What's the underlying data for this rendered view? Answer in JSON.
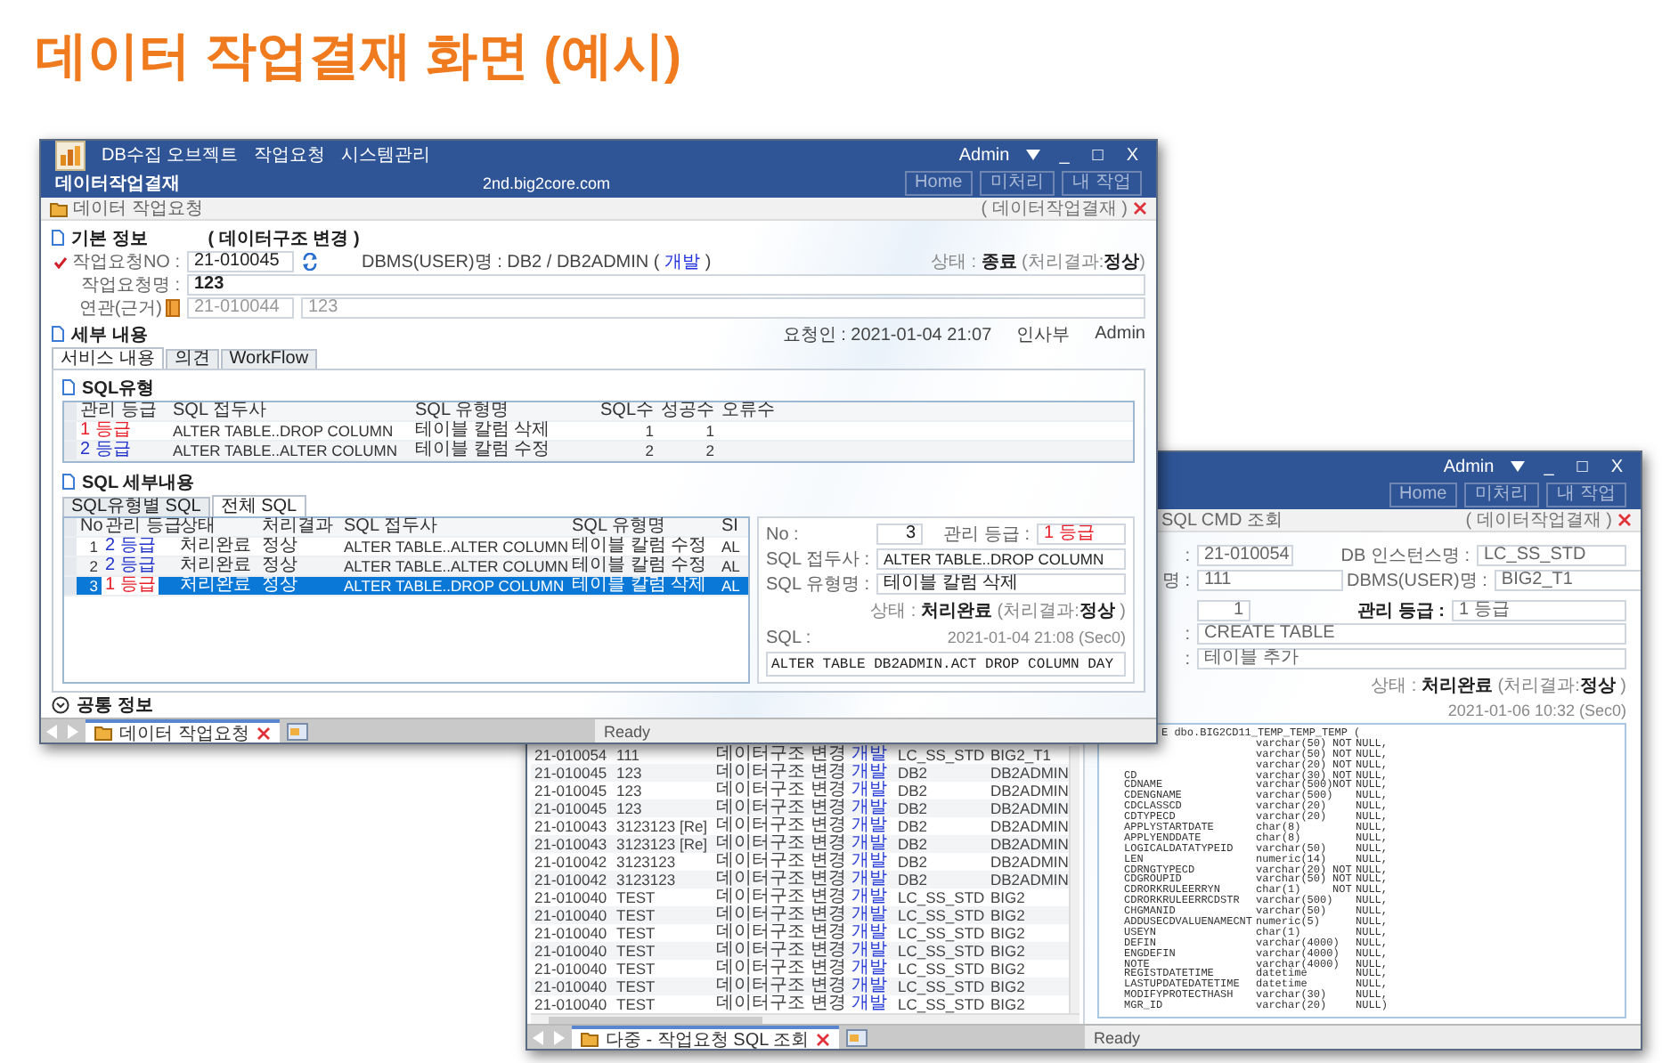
{
  "heading": "데이터 작업결재 화면 (예시)",
  "back_window": {
    "user": "Admin",
    "controls": [
      "_",
      "□",
      "X"
    ],
    "nav_buttons": [
      "Home",
      "미처리",
      "내 작업"
    ],
    "breadcrumb": "SQL CMD 조회",
    "breadcrumb_right": "( 데이터작업결재 )",
    "rows": [
      {
        "no": "21-010054",
        "name": "111",
        "type": "데이터구조 변경",
        "env": "개발",
        "instance": "LC_SS_STD",
        "user": "BIG2_T1"
      },
      {
        "no": "21-010045",
        "name": "123",
        "type": "데이터구조 변경",
        "env": "개발",
        "instance": "DB2",
        "user": "DB2ADMIN"
      },
      {
        "no": "21-010045",
        "name": "123",
        "type": "데이터구조 변경",
        "env": "개발",
        "instance": "DB2",
        "user": "DB2ADMIN"
      },
      {
        "no": "21-010045",
        "name": "123",
        "type": "데이터구조 변경",
        "env": "개발",
        "instance": "DB2",
        "user": "DB2ADMIN"
      },
      {
        "no": "21-010043",
        "name": "3123123 [Re]",
        "type": "데이터구조 변경",
        "env": "개발",
        "instance": "DB2",
        "user": "DB2ADMIN"
      },
      {
        "no": "21-010043",
        "name": "3123123 [Re]",
        "type": "데이터구조 변경",
        "env": "개발",
        "instance": "DB2",
        "user": "DB2ADMIN"
      },
      {
        "no": "21-010042",
        "name": "3123123",
        "type": "데이터구조 변경",
        "env": "개발",
        "instance": "DB2",
        "user": "DB2ADMIN"
      },
      {
        "no": "21-010042",
        "name": "3123123",
        "type": "데이터구조 변경",
        "env": "개발",
        "instance": "DB2",
        "user": "DB2ADMIN"
      },
      {
        "no": "21-010040",
        "name": "TEST",
        "type": "데이터구조 변경",
        "env": "개발",
        "instance": "LC_SS_STD",
        "user": "BIG2"
      },
      {
        "no": "21-010040",
        "name": "TEST",
        "type": "데이터구조 변경",
        "env": "개발",
        "instance": "LC_SS_STD",
        "user": "BIG2"
      },
      {
        "no": "21-010040",
        "name": "TEST",
        "type": "데이터구조 변경",
        "env": "개발",
        "instance": "LC_SS_STD",
        "user": "BIG2"
      },
      {
        "no": "21-010040",
        "name": "TEST",
        "type": "데이터구조 변경",
        "env": "개발",
        "instance": "LC_SS_STD",
        "user": "BIG2"
      },
      {
        "no": "21-010040",
        "name": "TEST",
        "type": "데이터구조 변경",
        "env": "개발",
        "instance": "LC_SS_STD",
        "user": "BIG2"
      },
      {
        "no": "21-010040",
        "name": "TEST",
        "type": "데이터구조 변경",
        "env": "개발",
        "instance": "LC_SS_STD",
        "user": "BIG2"
      },
      {
        "no": "21-010040",
        "name": "TEST",
        "type": "데이터구조 변경",
        "env": "개발",
        "instance": "LC_SS_STD",
        "user": "BIG2"
      }
    ],
    "detail": {
      "no_label": ":",
      "no": "21-010054",
      "instance_label": "DB 인스턴스명 :",
      "instance": "LC_SS_STD",
      "name_label": "명 :",
      "name": "111",
      "dbms_label": "DBMS(USER)명 :",
      "dbms": "BIG2_T1",
      "seq": "1",
      "grade_label": "관리 등급 :",
      "grade": "1 등급",
      "prefix_label": ":",
      "prefix": "CREATE TABLE",
      "type_label": ":",
      "type": "테이블 추가",
      "status": "상태 : **처리완료** (처리결과:**정상** )",
      "time": "2021-01-06 10:32 (Sec0)",
      "sql_lines": [
        {
          "kind": "header",
          "text": "E dbo.BIG2CD11_TEMP_TEMP_TEMP ("
        },
        {
          "kind": "column",
          "type": "varchar(50)",
          "not": "NOT",
          "null": "NULL,"
        },
        {
          "kind": "column",
          "type": "varchar(50)",
          "not": "NOT",
          "null": "NULL,"
        },
        {
          "kind": "column",
          "type": "varchar(20)",
          "not": "NOT",
          "null": "NULL,"
        },
        {
          "kind": "column",
          "name": "CD",
          "type": "varchar(30)",
          "not": "NOT",
          "null": "NULL,"
        },
        {
          "kind": "column",
          "name": "CDNAME",
          "type": "varchar(500)",
          "not": "NOT",
          "null": "NULL,"
        },
        {
          "kind": "column",
          "name": "CDENGNAME",
          "type": "varchar(500)",
          "null": "NULL,"
        },
        {
          "kind": "column",
          "name": "CDCLASSCD",
          "type": "varchar(20)",
          "null": "NULL,"
        },
        {
          "kind": "column",
          "name": "CDTYPECD",
          "type": "varchar(20)",
          "null": "NULL,"
        },
        {
          "kind": "column",
          "name": "APPLYSTARTDATE",
          "type": "char(8)",
          "null": "NULL,"
        },
        {
          "kind": "column",
          "name": "APPLYENDDATE",
          "type": "char(8)",
          "null": "NULL,"
        },
        {
          "kind": "column",
          "name": "LOGICALDATATYPEID",
          "type": "varchar(50)",
          "null": "NULL,"
        },
        {
          "kind": "column",
          "name": "LEN",
          "type": "numeric(14)",
          "null": "NULL,"
        },
        {
          "kind": "column",
          "name": "CDRNGTYPECD",
          "type": "varchar(20)",
          "not": "NOT",
          "null": "NULL,"
        },
        {
          "kind": "column",
          "name": "CDGROUPID",
          "type": "varchar(50)",
          "not": "NOT",
          "null": "NULL,"
        },
        {
          "kind": "column",
          "name": "CDRORKRULEERRYN",
          "type": "char(1)",
          "not": "NOT",
          "null": "NULL,"
        },
        {
          "kind": "column",
          "name": "CDRORKRULEERRCDSTR",
          "type": "varchar(500)",
          "null": "NULL,"
        },
        {
          "kind": "column",
          "name": "CHGMANID",
          "type": "varchar(50)",
          "null": "NULL,"
        },
        {
          "kind": "column",
          "name": "ADDUSECDVALUENAMECNT",
          "type": "numeric(5)",
          "null": "NULL,"
        },
        {
          "kind": "column",
          "name": "USEYN",
          "type": "char(1)",
          "null": "NULL,"
        },
        {
          "kind": "column",
          "name": "DEFIN",
          "type": "varchar(4000)",
          "null": "NULL,"
        },
        {
          "kind": "column",
          "name": "ENGDEFIN",
          "type": "varchar(4000)",
          "null": "NULL,"
        },
        {
          "kind": "column",
          "name": "NOTE",
          "type": "varchar(4000)",
          "null": "NULL,"
        },
        {
          "kind": "column",
          "name": "REGISTDATETIME",
          "type": "datetime",
          "null": "NULL,"
        },
        {
          "kind": "column",
          "name": "LASTUPDATEDATETIME",
          "type": "datetime",
          "null": "NULL,"
        },
        {
          "kind": "column",
          "name": "MODIFYPROTECTHASH",
          "type": "varchar(30)",
          "null": "NULL,"
        },
        {
          "kind": "column",
          "name": "MGR_ID",
          "type": "varchar(20)",
          "null": "NULL)"
        }
      ]
    },
    "tabs": [
      {
        "label": "다중 - 작업요청 SQL 조회",
        "selected": true
      }
    ],
    "status": "Ready"
  },
  "front_window": {
    "menu": [
      "DB수집 오브젝트",
      "작업요청",
      "시스템관리"
    ],
    "user": "Admin",
    "controls": [
      "_",
      "□",
      "X"
    ],
    "app_title": "데이터작업결재",
    "host": "2nd.big2core.com",
    "nav_buttons": [
      "Home",
      "미처리",
      "내 작업"
    ],
    "breadcrumb": "데이터 작업요청",
    "breadcrumb_right": "( 데이터작업결재 )",
    "basic_info": {
      "title": "기본 정보",
      "category": "( 데이터구조 변경 )",
      "request_no": {
        "label": "작업요청NO :",
        "value": "21-010045",
        "required": true
      },
      "dbms": {
        "prefix": "DBMS(USER)명 : DB2 / DB2ADMIN (",
        "link": "개발",
        "suffix": ")"
      },
      "status": "상태 : **종료** (처리결과:**정상**)",
      "request_name": {
        "label": "작업요청명 :",
        "value": "123"
      },
      "related": {
        "label": "연관(근거)",
        "no": "21-010044",
        "name": "123"
      }
    },
    "detail": {
      "title": "세부 내용",
      "requester": "요청인 : 2021-01-04 21:07",
      "dept": "인사부",
      "user": "Admin",
      "tabs": [
        {
          "label": "서비스 내용",
          "selected": true
        },
        {
          "label": "의견",
          "selected": false
        },
        {
          "label": "WorkFlow",
          "selected": false
        }
      ],
      "sql_type": {
        "title": "SQL유형",
        "columns": [
          "관리 등급",
          "SQL 접두사",
          "SQL 유형명",
          "SQL수",
          "성공수",
          "오류수"
        ],
        "rows": [
          {
            "grade": "1 등급",
            "color": "#e8202a",
            "prefix": "ALTER TABLE..DROP COLUMN",
            "type": "테이블 칼럼 삭제",
            "sql_count": "1",
            "success": "1"
          },
          {
            "grade": "2 등급",
            "color": "#2233cc",
            "prefix": "ALTER TABLE..ALTER COLUMN",
            "type": "테이블 칼럼 수정",
            "sql_count": "2",
            "success": "2"
          }
        ]
      },
      "sql_detail": {
        "title": "SQL 세부내용",
        "tabs": [
          {
            "label": "SQL유형별 SQL",
            "selected": false
          },
          {
            "label": "전체 SQL",
            "selected": true
          }
        ],
        "columns": [
          "No",
          "관리 등급",
          "상태",
          "처리결과",
          "SQL 접두사",
          "SQL 유형명",
          "SI"
        ],
        "rows": [
          {
            "no": "1",
            "grade": "2 등급",
            "color": "#2233cc",
            "state": "처리완료",
            "result": "정상",
            "prefix": "ALTER TABLE..ALTER COLUMN",
            "type": "테이블 칼럼 수정",
            "sql": "AL",
            "selected": false
          },
          {
            "no": "2",
            "grade": "2 등급",
            "color": "#2233cc",
            "state": "처리완료",
            "result": "정상",
            "prefix": "ALTER TABLE..ALTER COLUMN",
            "type": "테이블 칼럼 수정",
            "sql": "AL",
            "selected": false
          },
          {
            "no": "3",
            "grade": "1 등급",
            "color": "#e8202a",
            "state": "처리완료",
            "result": "정상",
            "prefix": "ALTER TABLE..DROP COLUMN",
            "type": "테이블 칼럼 삭제",
            "sql": "AL",
            "selected": true
          }
        ],
        "form": {
          "no_label": "No :",
          "no": "3",
          "grade_label": "관리 등급 :",
          "grade": {
            "value": "1 등급",
            "color": "#e8202a"
          },
          "prefix_label": "SQL 접두사 :",
          "prefix": "ALTER TABLE..DROP COLUMN",
          "type_label": "SQL 유형명 :",
          "type": "테이블 칼럼 삭제",
          "status": "상태 : **처리완료** (처리결과:**정상** )",
          "sql_label": "SQL :",
          "time": "2021-01-04 21:08 (Sec0)",
          "sql": "ALTER TABLE DB2ADMIN.ACT DROP COLUMN DAY"
        }
      }
    },
    "common_info": "공통 정보",
    "tabs": [
      {
        "label": "데이터 작업요청",
        "selected": true
      }
    ],
    "status": "Ready"
  }
}
